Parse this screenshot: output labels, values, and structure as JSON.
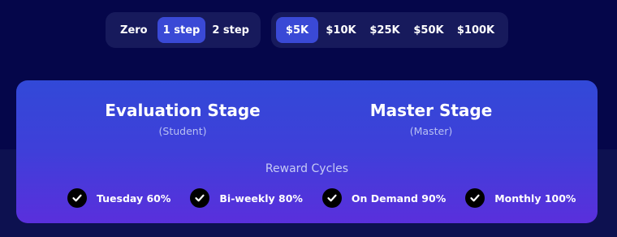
{
  "step_toggle": {
    "options": [
      "Zero",
      "1 step",
      "2 step"
    ],
    "selected": "1 step"
  },
  "size_toggle": {
    "options": [
      "$5K",
      "$10K",
      "$25K",
      "$50K",
      "$100K"
    ],
    "selected": "$5K"
  },
  "card": {
    "evaluation": {
      "title": "Evaluation Stage",
      "subtitle": "(Student)"
    },
    "master": {
      "title": "Master Stage",
      "subtitle": "(Master)"
    },
    "reward_cycles_title": "Reward Cycles",
    "cycles": [
      "Tuesday 60%",
      "Bi-weekly 80%",
      "On Demand 90%",
      "Monthly 100%"
    ]
  },
  "colors": {
    "background": "#05064a",
    "active_pill": "#3a49d6",
    "card_top": "#3249d8",
    "card_bottom": "#5a2fdc"
  }
}
